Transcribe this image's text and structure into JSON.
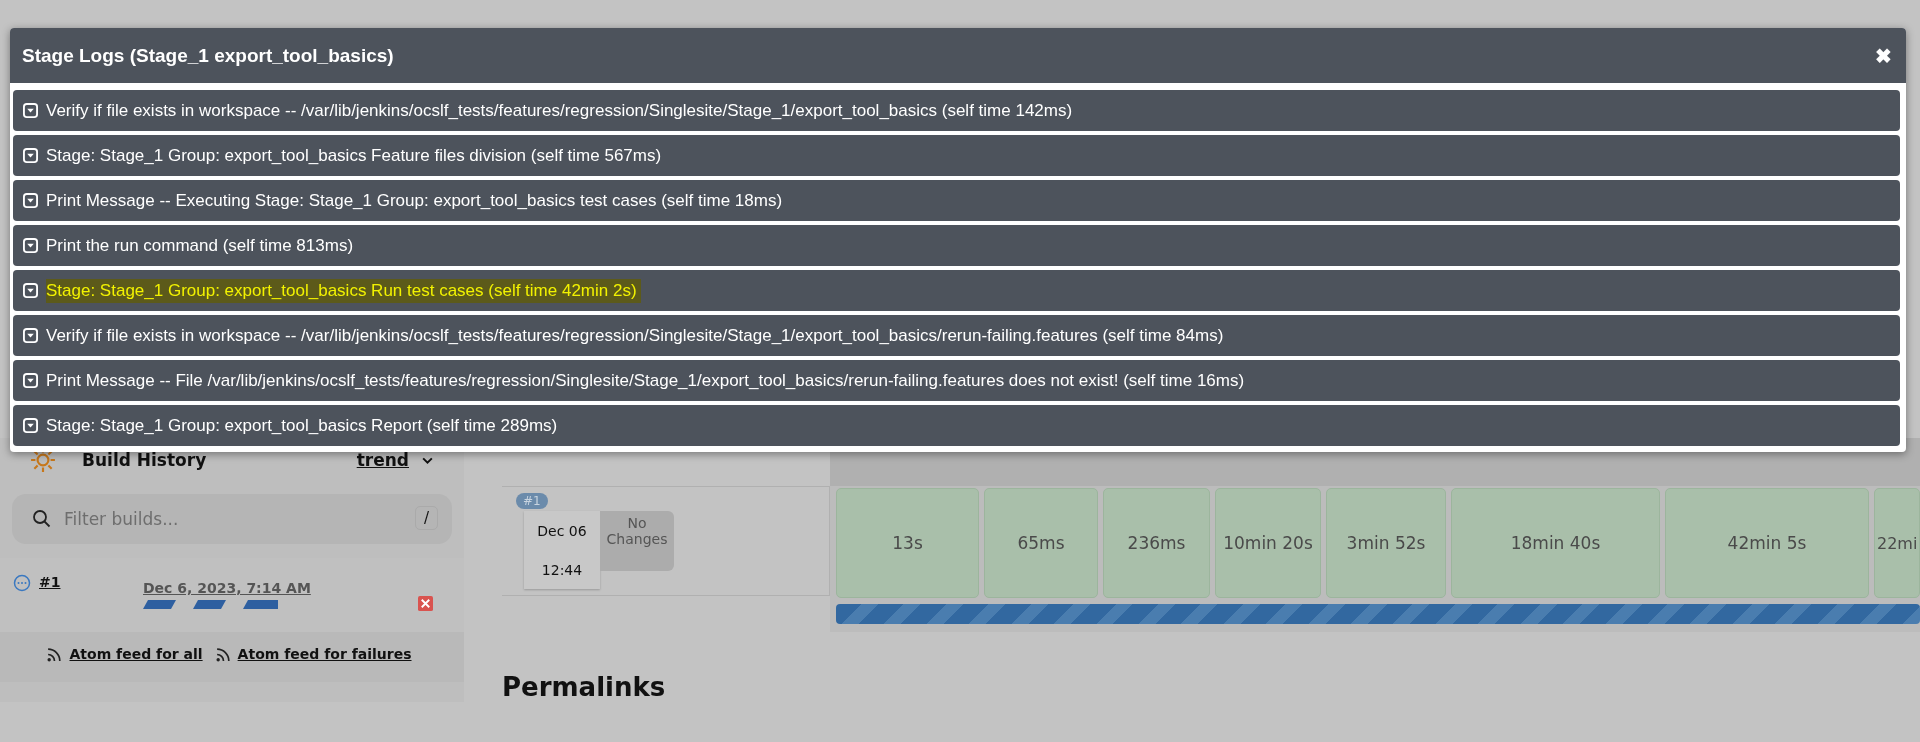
{
  "modal": {
    "title": "Stage Logs (Stage_1 export_tool_basics)",
    "close": "✖",
    "logs": [
      {
        "text": "Verify if file exists in workspace -- /var/lib/jenkins/ocslf_tests/features/regression/Singlesite/Stage_1/export_tool_basics (self time 142ms)",
        "highlighted": false
      },
      {
        "text": "Stage: Stage_1 Group: export_tool_basics Feature files division (self time 567ms)",
        "highlighted": false
      },
      {
        "text": "Print Message -- Executing Stage: Stage_1 Group: export_tool_basics test cases (self time 18ms)",
        "highlighted": false
      },
      {
        "text": "Print the run command (self time 813ms)",
        "highlighted": false
      },
      {
        "text": "Stage: Stage_1 Group: export_tool_basics Run test cases (self time 42min 2s)",
        "highlighted": true
      },
      {
        "text": "Verify if file exists in workspace -- /var/lib/jenkins/ocslf_tests/features/regression/Singlesite/Stage_1/export_tool_basics/rerun-failing.features (self time 84ms)",
        "highlighted": false
      },
      {
        "text": "Print Message -- File /var/lib/jenkins/ocslf_tests/features/regression/Singlesite/Stage_1/export_tool_basics/rerun-failing.features does not exist! (self time 16ms)",
        "highlighted": false
      },
      {
        "text": "Stage: Stage_1 Group: export_tool_basics Report (self time 289ms)",
        "highlighted": false
      }
    ]
  },
  "sidebar": {
    "title": "Build History",
    "trend": "trend",
    "filter": {
      "placeholder": "Filter builds...",
      "shortcut": "/"
    },
    "builds": [
      {
        "number": "#1",
        "date": "Dec 6, 2023, 7:14 AM"
      }
    ],
    "feeds": [
      "Atom feed for all",
      "Atom feed for failures"
    ]
  },
  "stage_view": {
    "build": {
      "badge": "#1",
      "date": "Dec 06",
      "time": "12:44",
      "changes": "No Changes"
    },
    "durations": [
      "13s",
      "65ms",
      "236ms",
      "10min 20s",
      "3min 52s",
      "18min 40s",
      "42min 5s",
      "22mi"
    ],
    "progress": {
      "level": 1
    }
  },
  "permalinks_title": "Permalinks"
}
